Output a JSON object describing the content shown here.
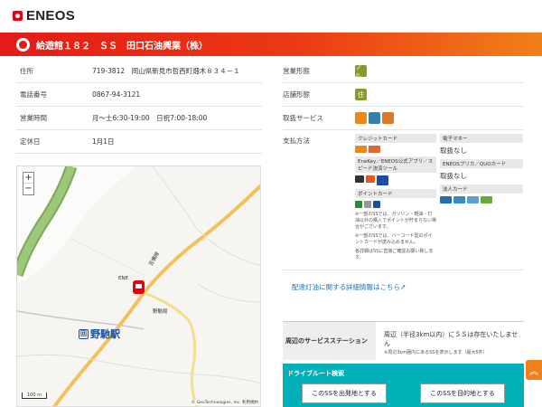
{
  "brand": {
    "name": "ENEOS"
  },
  "station": {
    "title": "給遊館１８２　ＳＳ　田口石油興業（株）"
  },
  "info": [
    {
      "key": "住所",
      "value": "719-3812　岡山県新見市哲西町畑木８３４－１"
    },
    {
      "key": "電話番号",
      "value": "0867-94-3121"
    },
    {
      "key": "営業時間",
      "value": "月～土6:30-19:00　日祝7:00-18:00"
    },
    {
      "key": "定休日",
      "value": "1月1日"
    }
  ],
  "right": {
    "type_label": "営業形態",
    "type_icon": "フル",
    "store_label": "店舗形態",
    "store_icon": "住",
    "service_label": "取扱サービス",
    "payment_label": "支払方法",
    "credit_header": "クレジットカード",
    "enekey_header": "EneKey／ENEOS公式アプリ／スピード決済ツール",
    "point_header": "ポイントカード",
    "point_notes": [
      "※一部のSSでは、ガソリン・軽油・灯油以外の購入でポイントが貯まらない場合がございます。",
      "※一部のSSでは、バーコード型のポイントカードが読み込めません。",
      "各詳細はSSに直接ご確認お願い致します。"
    ],
    "emoney_header": "電子マネー",
    "emoney_value": "取扱なし",
    "prica_header": "ENEOSプリカ／QUOカード",
    "prica_value": "取扱なし",
    "corp_header": "法人カード"
  },
  "link": {
    "text": "配達灯油に関する詳細情報はこちら"
  },
  "nearby": {
    "label": "周辺のサービスステーション",
    "value": "周辺（半径3km以内）にＳＳは存在いたしません",
    "note": "※周辺3km圏内にあるSSを表示します（最大5件）"
  },
  "drive": {
    "title": "ドライブルート検索",
    "from_button": "このSSを出発地とする",
    "to_button": "このSSを目的地とする"
  },
  "map": {
    "zoom_in": "+",
    "zoom_out": "−",
    "station_name": "野馳駅",
    "station_icon": "回",
    "label_ss": "ENE",
    "label_road": "芸備線",
    "label_yubin": "野馳局",
    "scale": "100 m",
    "attribution": "© GeoTechnologies, Inc.  利用規約"
  },
  "colors": {
    "accent": "#e60012",
    "teal": "#00b0b8",
    "orange": "#f08019"
  }
}
